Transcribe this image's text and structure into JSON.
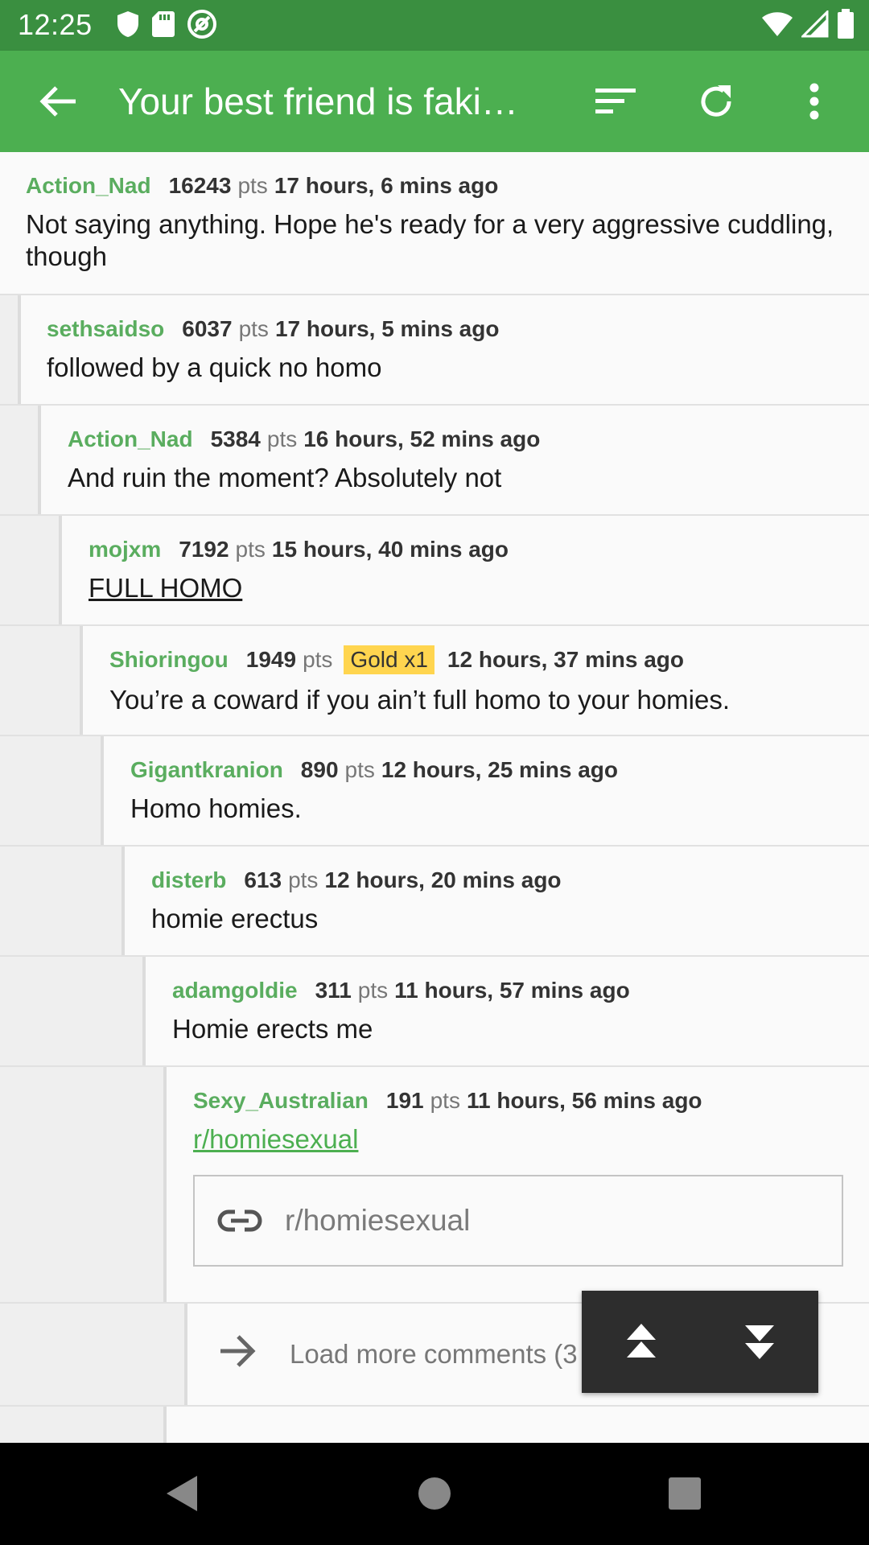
{
  "status_bar": {
    "time": "12:25",
    "left_icons": [
      "shield-icon",
      "sd-card-icon",
      "at-sign-icon"
    ],
    "right_icons": [
      "wifi-icon",
      "signal-icon",
      "battery-icon"
    ]
  },
  "toolbar": {
    "title": "Your best friend is faki…",
    "icons": [
      "back-arrow-icon",
      "sort-icon",
      "refresh-icon",
      "more-vert-icon"
    ]
  },
  "colors": {
    "status_bar": "#3a8f40",
    "toolbar": "#4caf50",
    "author": "#5aad5f",
    "gold_badge": "#ffd54f"
  },
  "comments": [
    {
      "author": "Action_Nad",
      "score": "16243",
      "pts": "pts",
      "time": "17 hours, 6 mins ago",
      "text": "Not saying anything.  Hope he's ready for a very aggressive cuddling, though",
      "depth": 0
    },
    {
      "author": "sethsaidso",
      "score": "6037",
      "pts": "pts",
      "time": "17 hours, 5 mins ago",
      "text": "followed by a quick no homo",
      "depth": 1
    },
    {
      "author": "Action_Nad",
      "score": "5384",
      "pts": "pts",
      "time": "16 hours, 52 mins ago",
      "text": "And ruin the moment? Absolutely not",
      "depth": 2
    },
    {
      "author": "mojxm",
      "score": "7192",
      "pts": "pts",
      "time": "15 hours, 40 mins ago",
      "text": "FULL HOMO",
      "depth": 3
    },
    {
      "author": "Shioringou",
      "score": "1949",
      "pts": "pts",
      "gold": "Gold x1",
      "time": "12 hours, 37 mins ago",
      "text": "You’re a coward if you ain’t full homo to your homies.",
      "depth": 4
    },
    {
      "author": "Gigantkranion",
      "score": "890",
      "pts": "pts",
      "time": "12 hours, 25 mins ago",
      "text": "Homo homies.",
      "depth": 5
    },
    {
      "author": "disterb",
      "score": "613",
      "pts": "pts",
      "time": "12 hours, 20 mins ago",
      "text": "homie erectus",
      "depth": 6
    },
    {
      "author": "adamgoldie",
      "score": "311",
      "pts": "pts",
      "time": "11 hours, 57 mins ago",
      "text": "Homie erects me",
      "depth": 7
    },
    {
      "author": "Sexy_Australian",
      "score": "191",
      "pts": "pts",
      "time": "11 hours, 56 mins ago",
      "text": "r/homiesexual",
      "link_preview": "r/homiesexual",
      "depth": 8
    }
  ],
  "load_more": {
    "label": "Load more comments (3 replies)",
    "depth": 9
  },
  "floating_nav": {
    "icons": [
      "scroll-up-icon",
      "scroll-down-icon"
    ]
  },
  "nav_bar": {
    "icons": [
      "back-triangle-icon",
      "home-circle-icon",
      "recents-square-icon"
    ]
  }
}
